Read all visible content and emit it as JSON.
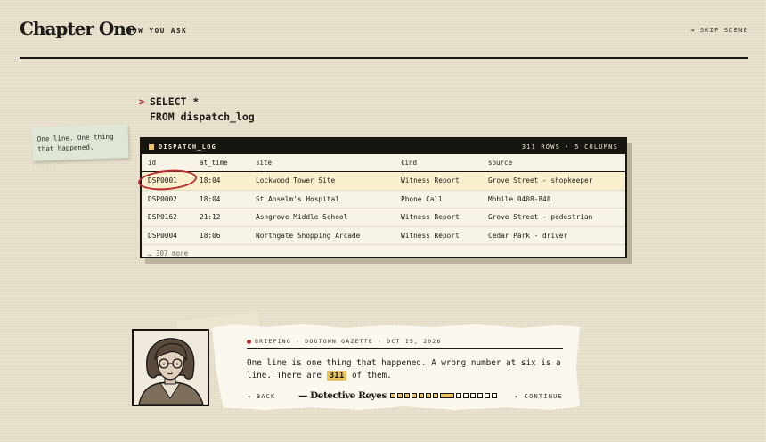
{
  "header": {
    "title": "Chapter One",
    "subtitle": "HOW YOU ASK",
    "skip_label": "⇥ SKIP SCENE"
  },
  "query": {
    "prompt": ">",
    "line1": "SELECT *",
    "line2": "FROM dispatch_log"
  },
  "sticky_note": {
    "text": "One line. One thing that happened."
  },
  "table": {
    "name": "DISPATCH_LOG",
    "summary": "311 ROWS · 5 COLUMNS",
    "columns": [
      "id",
      "at_time",
      "site",
      "kind",
      "source"
    ],
    "rows": [
      [
        "DSP0001",
        "18:04",
        "Lockwood Tower Site",
        "Witness Report",
        "Grove Street - shopkeeper"
      ],
      [
        "DSP0002",
        "18:04",
        "St Anselm's Hospital",
        "Phone Call",
        "Mobile 0408-848"
      ],
      [
        "DSP0162",
        "21:12",
        "Ashgrove Middle School",
        "Witness Report",
        "Grove Street - pedestrian"
      ],
      [
        "DSP0004",
        "18:06",
        "Northgate Shopping Arcade",
        "Witness Report",
        "Cedar Park - driver"
      ]
    ],
    "more": "… 307 more"
  },
  "briefing": {
    "meta": "BRIEFING · DOGTOWN GAZETTE · OCT 15, 2026",
    "text_before": "One line is one thing that happened. A wrong number at six is a line. There are ",
    "highlight": "311",
    "text_after": " of them.",
    "back_label": "◂ BACK",
    "signature": "— Detective Reyes",
    "continue_label": "▸ CONTINUE",
    "progress": {
      "total": 14,
      "current": 8
    }
  },
  "colors": {
    "background": "#e8e2ce",
    "ink": "#1d1b17",
    "accent_yellow": "#e7c25e",
    "accent_red": "#b83030",
    "row_highlight": "#fbf0cd"
  }
}
